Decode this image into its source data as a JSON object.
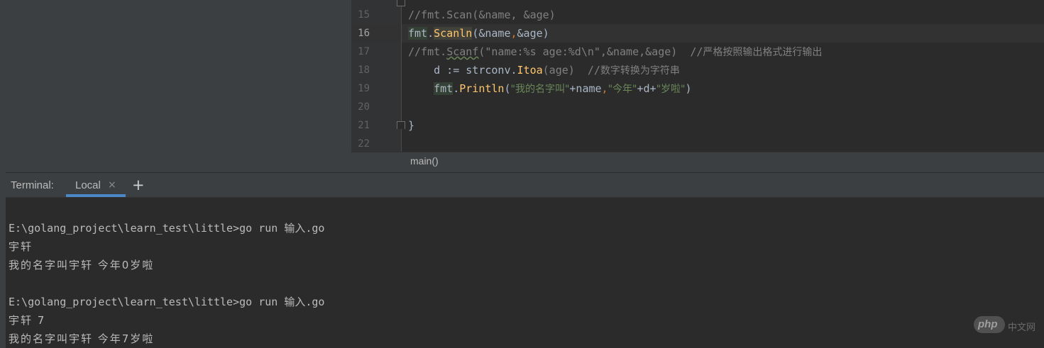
{
  "editor": {
    "line_numbers": [
      "15",
      "16",
      "17",
      "18",
      "19",
      "20",
      "21",
      "22"
    ],
    "active_line": "16",
    "lines": {
      "l15": "//fmt.Scan(&name, &age)",
      "l16": {
        "pkg": "fmt",
        "dot": ".",
        "func": "Scanln",
        "rest_a": "(&name",
        "comma": ",",
        "rest_b": "&age)"
      },
      "l17": {
        "a": "//fmt.",
        "b": "Scanf",
        "c": "(\"name:%s age:%d\\n\",&name,&age)  //",
        "cjk": "严格按照输出格式进行输出"
      },
      "l18": {
        "a": "    d := strconv.",
        "func": "Itoa",
        "b": "(age)  //",
        "cjk": "数字转换为字符串"
      },
      "l19": {
        "indent": "    ",
        "pkg": "fmt",
        "dot": ".",
        "func": "Println",
        "p1": "(",
        "s1": "\"我的名字叫\"",
        "p2": "+name",
        "c1": ",",
        "s2": "\"今年\"",
        "p3": "+d+",
        "s3": "\"岁啦\"",
        "p4": ")"
      },
      "l21": "}"
    }
  },
  "breadcrumb": {
    "label": "main()"
  },
  "terminal": {
    "title": "Terminal:",
    "tab_label": "Local",
    "tab_close": "×",
    "add_label": "+",
    "lines": [
      "E:\\golang_project\\learn_test\\little>go run 输入.go",
      "宇轩",
      "我的名字叫宇轩 今年0岁啦",
      "",
      "E:\\golang_project\\learn_test\\little>go run 输入.go",
      "宇轩 7",
      "我的名字叫宇轩 今年7岁啦"
    ]
  },
  "watermark": {
    "logo_text": "php",
    "suffix": "中文网"
  },
  "colors": {
    "editor_bg": "#2b2b2b",
    "panel_bg": "#3c3f41",
    "comment": "#808080",
    "string": "#6a8759",
    "function": "#ffc66d",
    "keyword_punct": "#cc7832",
    "text": "#a9b7c6",
    "tab_accent": "#4a88c7"
  }
}
